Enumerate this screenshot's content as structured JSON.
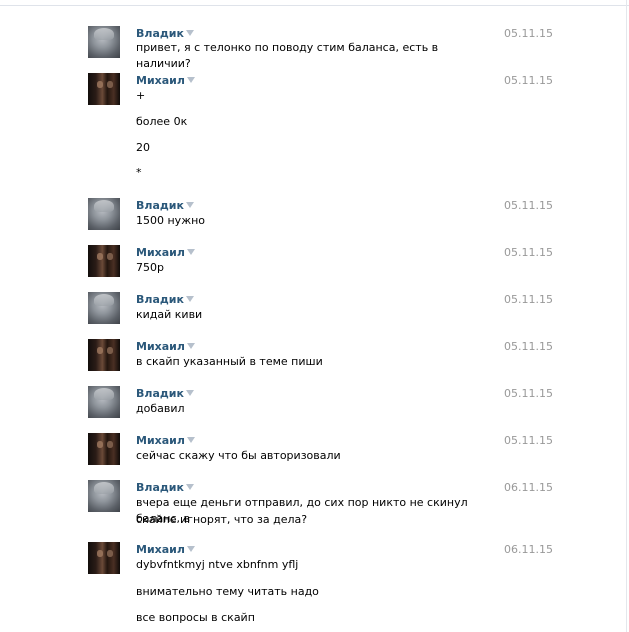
{
  "messages": [
    {
      "sender": "Владик",
      "avatar": "cat-avatar",
      "date": "05.11.15",
      "lines": [
        "привет, я с телонко по поводу стим баланса, есть в наличии?"
      ]
    },
    {
      "sender": "Михаил",
      "avatar": "dark-avatar",
      "date": "05.11.15",
      "lines": [
        "+",
        "более 0к",
        "20",
        "*"
      ]
    },
    {
      "sender": "Владик",
      "avatar": "cat-avatar",
      "date": "05.11.15",
      "lines": [
        "1500 нужно"
      ]
    },
    {
      "sender": "Михаил",
      "avatar": "dark-avatar",
      "date": "05.11.15",
      "lines": [
        "750р"
      ]
    },
    {
      "sender": "Владик",
      "avatar": "cat-avatar",
      "date": "05.11.15",
      "lines": [
        "кидай киви"
      ]
    },
    {
      "sender": "Михаил",
      "avatar": "dark-avatar",
      "date": "05.11.15",
      "lines": [
        "в скайп указанный в теме пиши"
      ]
    },
    {
      "sender": "Владик",
      "avatar": "cat-avatar",
      "date": "05.11.15",
      "lines": [
        "добавил"
      ]
    },
    {
      "sender": "Михаил",
      "avatar": "dark-avatar",
      "date": "05.11.15",
      "lines": [
        "сейчас скажу что бы авторизовали"
      ]
    },
    {
      "sender": "Владик",
      "avatar": "cat-avatar",
      "date": "06.11.15",
      "lines": [
        "вчера еще деньги отправил, до сих пор никто не скинул баланс, в",
        "скайпе игнорят, что за дела?"
      ]
    },
    {
      "sender": "Михаил",
      "avatar": "dark-avatar",
      "date": "06.11.15",
      "lines": [
        "dybvfntkmyj ntve xbnfnm yflj",
        "внимательно тему читать надо",
        "все вопросы в скайп"
      ]
    }
  ]
}
